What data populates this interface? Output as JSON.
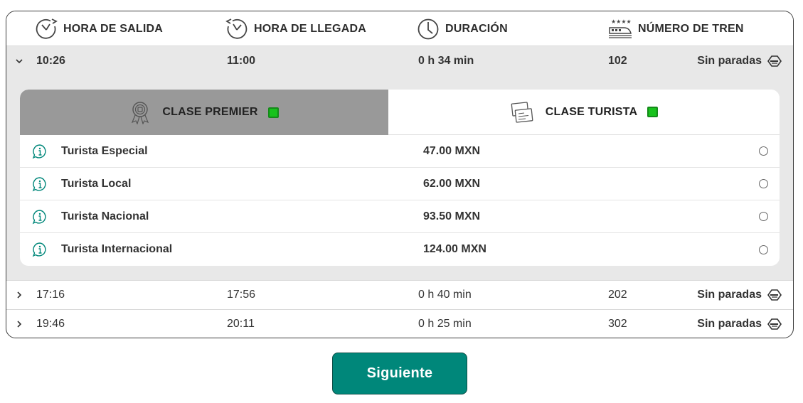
{
  "header": {
    "departure": "HORA DE SALIDA",
    "arrival": "HORA DE LLEGADA",
    "duration": "DURACIÓN",
    "train_number": "NÚMERO DE TREN"
  },
  "trips": [
    {
      "departure": "10:26",
      "arrival": "11:00",
      "duration": "0 h 34 min",
      "train": "102",
      "stops": "Sin paradas",
      "expanded": true
    },
    {
      "departure": "17:16",
      "arrival": "17:56",
      "duration": "0 h 40 min",
      "train": "202",
      "stops": "Sin paradas",
      "expanded": false
    },
    {
      "departure": "19:46",
      "arrival": "20:11",
      "duration": "0 h 25 min",
      "train": "302",
      "stops": "Sin paradas",
      "expanded": false
    }
  ],
  "classes": {
    "premier": {
      "label": "CLASE PREMIER",
      "selected": false
    },
    "turista": {
      "label": "CLASE TURISTA",
      "selected": true
    }
  },
  "fares": [
    {
      "name": "Turista Especial",
      "price": "47.00 MXN"
    },
    {
      "name": "Turista Local",
      "price": "62.00 MXN"
    },
    {
      "name": "Turista Nacional",
      "price": "93.50 MXN"
    },
    {
      "name": "Turista Internacional",
      "price": "124.00 MXN"
    }
  ],
  "next_button": "Siguiente",
  "colors": {
    "accent": "#00877a",
    "available": "#18c21c",
    "selected_row_bg": "#e8e8e8",
    "inactive_tab_bg": "#999999"
  }
}
